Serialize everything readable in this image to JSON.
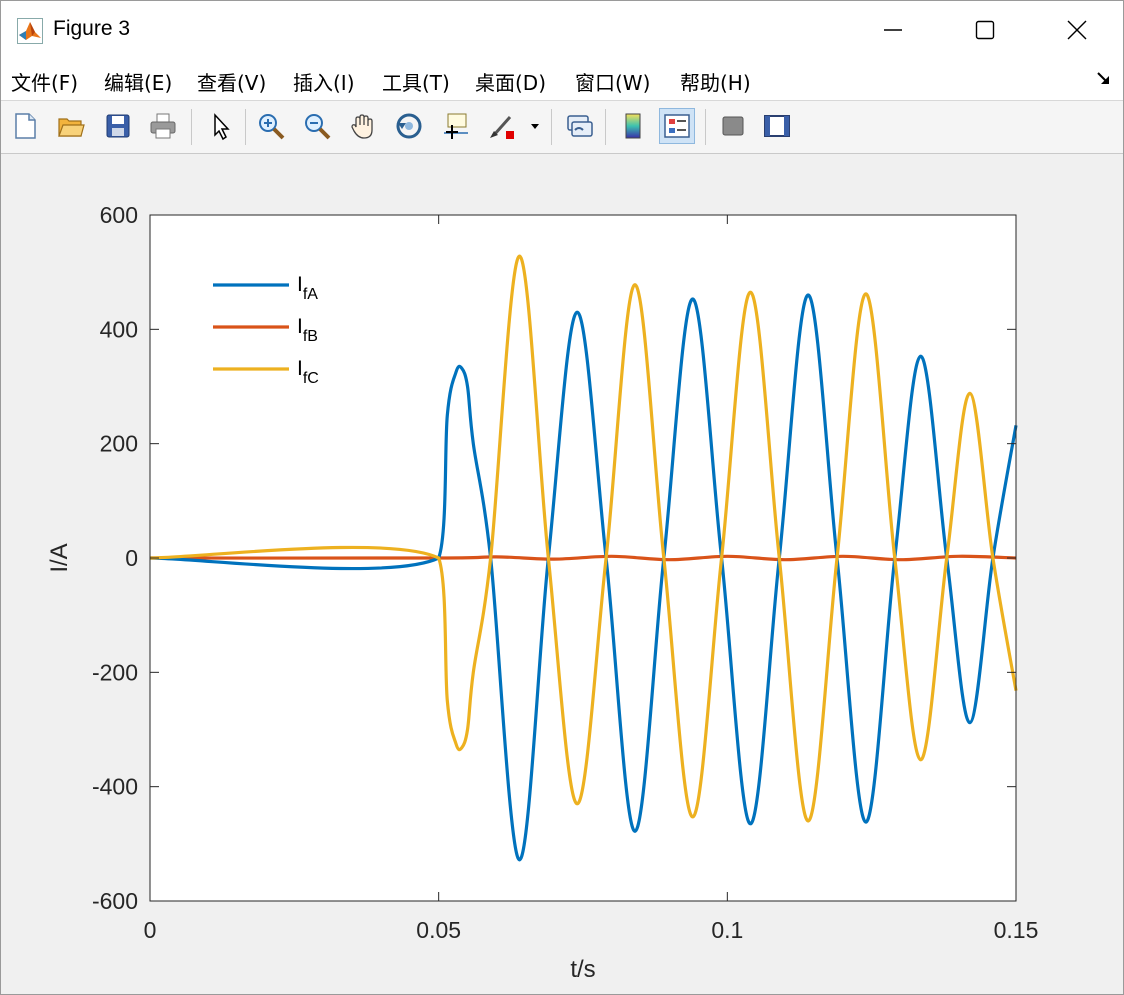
{
  "window": {
    "title": "Figure 3"
  },
  "menu": {
    "items": [
      "文件(F)",
      "编辑(E)",
      "查看(V)",
      "插入(I)",
      "工具(T)",
      "桌面(D)",
      "窗口(W)",
      "帮助(H)"
    ]
  },
  "toolbar": {
    "icons": [
      "new-figure-icon",
      "open-file-icon",
      "save-icon",
      "print-icon",
      "pointer-icon",
      "zoom-in-icon",
      "zoom-out-icon",
      "pan-hand-icon",
      "rotate-3d-icon",
      "data-cursor-icon",
      "brush-icon",
      "link-plot-icon",
      "colorbar-icon",
      "legend-icon",
      "hide-plot-tools-icon",
      "show-plot-tools-icon"
    ]
  },
  "chart_data": {
    "type": "line",
    "xlabel": "t/s",
    "ylabel": "I/A",
    "xlim": [
      0,
      0.15
    ],
    "ylim": [
      -600,
      600
    ],
    "xticks": [
      0,
      0.05,
      0.1,
      0.15
    ],
    "xtick_labels": [
      "0",
      "0.05",
      "0.1",
      "0.15"
    ],
    "yticks": [
      600,
      400,
      200,
      0,
      -200,
      -400,
      -600
    ],
    "ytick_labels": [
      "600",
      "400",
      "200",
      "0",
      "-200",
      "-400",
      "-600"
    ],
    "grid": false,
    "legend": {
      "placement": "top-left",
      "entries": [
        {
          "main": "I",
          "sub": "fA"
        },
        {
          "main": "I",
          "sub": "fB"
        },
        {
          "main": "I",
          "sub": "fC"
        }
      ]
    },
    "series": [
      {
        "name": "IfA",
        "color": "#0072BD",
        "x": [
          0,
          0.05,
          0.0515,
          0.053,
          0.054,
          0.055,
          0.056,
          0.059,
          0.064,
          0.069,
          0.074,
          0.079,
          0.084,
          0.089,
          0.094,
          0.099,
          0.104,
          0.109,
          0.114,
          0.119,
          0.124,
          0.129,
          0.1335,
          0.138,
          0.142,
          0.146,
          0.15
        ],
        "y": [
          0,
          0,
          250,
          325,
          332,
          300,
          200,
          0,
          -528,
          0,
          430,
          0,
          -478,
          0,
          453,
          0,
          -465,
          0,
          460,
          0,
          -462,
          0,
          353,
          0,
          -288,
          0,
          232
        ]
      },
      {
        "name": "IfB",
        "color": "#D95319",
        "x": [
          0,
          0.05,
          0.06,
          0.07,
          0.08,
          0.09,
          0.1,
          0.11,
          0.12,
          0.13,
          0.14,
          0.15
        ],
        "y": [
          0,
          0,
          2,
          -2,
          3,
          -3,
          3,
          -3,
          3,
          -3,
          3,
          0
        ]
      },
      {
        "name": "IfC",
        "color": "#EDB120",
        "x": [
          0,
          0.05,
          0.0515,
          0.053,
          0.054,
          0.055,
          0.056,
          0.059,
          0.064,
          0.069,
          0.074,
          0.079,
          0.084,
          0.089,
          0.094,
          0.099,
          0.104,
          0.109,
          0.114,
          0.119,
          0.124,
          0.129,
          0.1335,
          0.138,
          0.142,
          0.146,
          0.15
        ],
        "y": [
          0,
          0,
          -250,
          -325,
          -332,
          -300,
          -200,
          0,
          528,
          0,
          -430,
          0,
          478,
          0,
          -453,
          0,
          465,
          0,
          -460,
          0,
          462,
          0,
          -353,
          0,
          288,
          0,
          -232
        ]
      }
    ]
  }
}
